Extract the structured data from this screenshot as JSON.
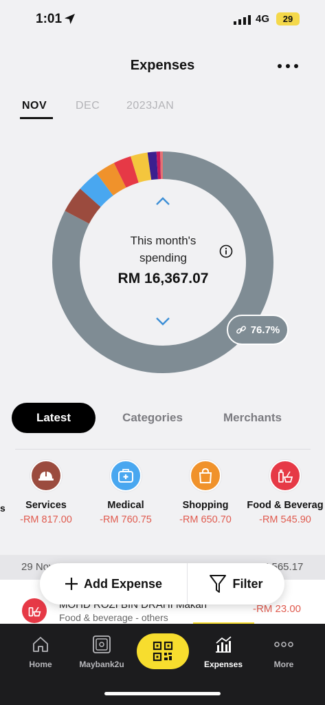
{
  "status_bar": {
    "time": "1:01",
    "network": "4G",
    "battery": "29"
  },
  "header": {
    "title": "Expenses"
  },
  "months": [
    "NOV",
    "DEC",
    "2023JAN"
  ],
  "summary": {
    "label": "This month's spending",
    "amount": "RM 16,367.07",
    "share_percent": "76.7%"
  },
  "chart_data": {
    "type": "pie",
    "values": [
      76.7,
      3.6,
      3.0,
      2.7,
      2.4,
      2.3,
      1.2,
      0.5,
      0.4
    ],
    "colors": [
      "#7f8c94",
      "#9b4b3e",
      "#49a7f0",
      "#f0922b",
      "#e63946",
      "#f4c63d",
      "#3a1f8f",
      "#c2185b",
      "#e57373"
    ]
  },
  "segments": [
    "Latest",
    "Categories",
    "Merchants"
  ],
  "categories": [
    {
      "name": "Services",
      "amount": "-RM 817.00",
      "color": "#9b4b3e"
    },
    {
      "name": "Medical",
      "amount": "-RM 760.75",
      "color": "#49a7f0"
    },
    {
      "name": "Shopping",
      "amount": "-RM 650.70",
      "color": "#f0922b"
    },
    {
      "name": "Food & Beverag",
      "amount": "-RM 545.90",
      "color": "#e63946"
    }
  ],
  "day_group": {
    "date": "29 Nov 2022",
    "total": "RM 565.17"
  },
  "transaction": {
    "title": "MOHD ROZI BIN DRAHI Makan",
    "category": "Food & beverage - others",
    "amount": "-RM 23.00"
  },
  "actions": {
    "add": "Add Expense",
    "filter": "Filter"
  },
  "tabs": [
    "Home",
    "Maybank2u",
    "Expenses",
    "More"
  ]
}
